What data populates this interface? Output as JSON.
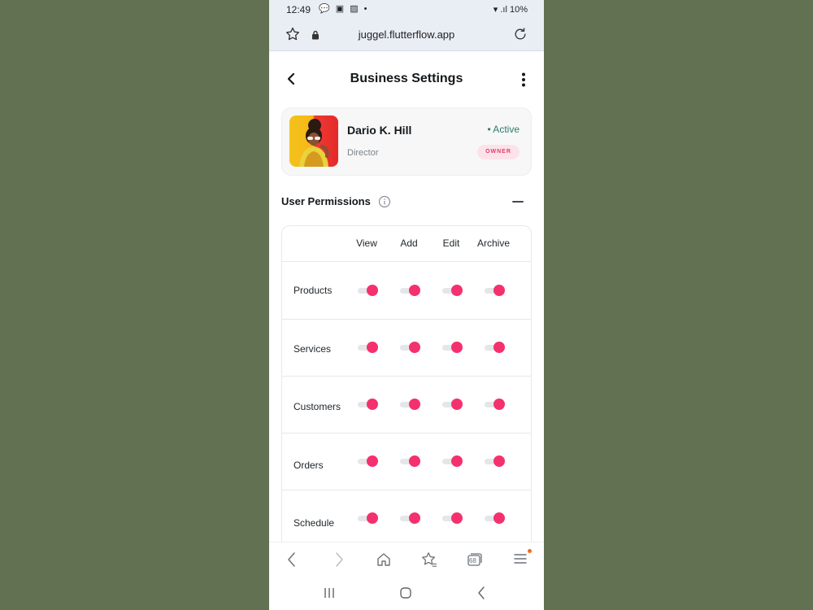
{
  "status_bar": {
    "time": "12:49",
    "notif_icons": "💬 ▣ ▨ •",
    "right": "10%"
  },
  "browser": {
    "url": "juggel.flutterflow.app",
    "tab_count": "68"
  },
  "app_bar": {
    "title": "Business Settings"
  },
  "profile": {
    "name": "Dario K. Hill",
    "role": "Director",
    "status": "• Active",
    "badge": "OWNER"
  },
  "permissions": {
    "title": "User Permissions",
    "columns": [
      "View",
      "Add",
      "Edit",
      "Archive"
    ],
    "rows": [
      {
        "label": "Products",
        "view": true,
        "add": true,
        "edit": true,
        "archive": true
      },
      {
        "label": "Services",
        "view": true,
        "add": true,
        "edit": true,
        "archive": true
      },
      {
        "label": "Customers",
        "view": true,
        "add": true,
        "edit": true,
        "archive": true
      },
      {
        "label": "Orders",
        "view": true,
        "add": true,
        "edit": true,
        "archive": true
      },
      {
        "label": "Schedule",
        "view": true,
        "add": true,
        "edit": true,
        "archive": true
      }
    ]
  },
  "colors": {
    "accent": "#f4316e",
    "active": "#2f7a66",
    "badge_bg": "#fce3ea",
    "background": "#627152"
  }
}
